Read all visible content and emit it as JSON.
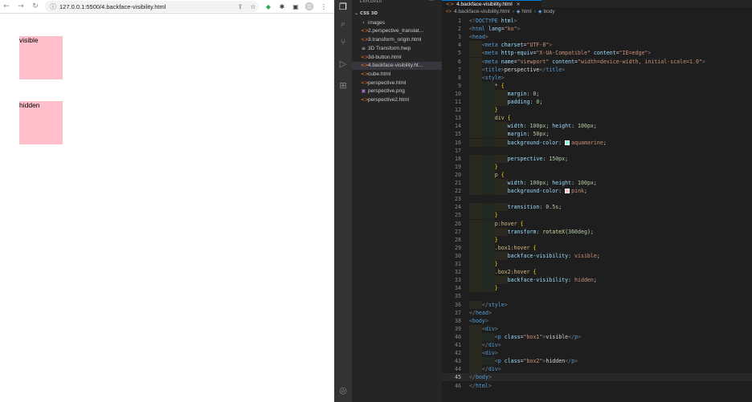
{
  "browser": {
    "url": "127.0.0.1:5500/4.backface-visibility.html",
    "boxes": [
      {
        "label": "visible"
      },
      {
        "label": "hidden"
      }
    ]
  },
  "vscode": {
    "explorer_title": "EXPLORER",
    "explorer_more": "···",
    "folder": "CSS 3D",
    "files": [
      {
        "name": "images",
        "icon": "folder-chevron-icon",
        "icon_color": "#cccccc"
      },
      {
        "name": "2.perspective_translat...",
        "icon": "html-file-icon",
        "icon_color": "#e37933"
      },
      {
        "name": "3.transform_origin.html",
        "icon": "html-file-icon",
        "icon_color": "#e37933"
      },
      {
        "name": "3D Transform.hwp",
        "icon": "lines-file-icon",
        "icon_color": "#cccccc"
      },
      {
        "name": "3d-button.html",
        "icon": "html-file-icon",
        "icon_color": "#e37933"
      },
      {
        "name": "4.backface-visibility.ht...",
        "icon": "html-file-icon",
        "icon_color": "#e37933"
      },
      {
        "name": "cube.html",
        "icon": "html-file-icon",
        "icon_color": "#e37933"
      },
      {
        "name": "perspective.html",
        "icon": "html-file-icon",
        "icon_color": "#e37933"
      },
      {
        "name": "perspective.png",
        "icon": "image-file-icon",
        "icon_color": "#a074c4"
      },
      {
        "name": "perspective2.html",
        "icon": "html-file-icon",
        "icon_color": "#e37933"
      }
    ],
    "tab": {
      "name": "4.backface-visibility.html",
      "close": "×"
    },
    "breadcrumb": [
      "4.backface-visibility.html",
      "html",
      "body"
    ],
    "current_line": 45,
    "code": [
      [
        [
          "c-punc",
          "<!"
        ],
        [
          "c-tag",
          "DOCTYPE"
        ],
        [
          "c-attr",
          " html"
        ],
        [
          "c-punc",
          ">"
        ]
      ],
      [
        [
          "c-punc",
          "<"
        ],
        [
          "c-tag",
          "html"
        ],
        [
          "c-attr",
          " lang"
        ],
        [
          "c-text",
          "="
        ],
        [
          "c-str",
          "\"ko\""
        ],
        [
          "c-punc",
          ">"
        ]
      ],
      [
        [
          "c-punc",
          "<"
        ],
        [
          "c-tag",
          "head"
        ],
        [
          "c-punc",
          ">"
        ]
      ],
      [
        [
          "c-text",
          "    "
        ],
        [
          "c-punc",
          "<"
        ],
        [
          "c-tag",
          "meta"
        ],
        [
          "c-attr",
          " charset"
        ],
        [
          "c-text",
          "="
        ],
        [
          "c-str",
          "\"UTF-8\""
        ],
        [
          "c-punc",
          ">"
        ]
      ],
      [
        [
          "c-text",
          "    "
        ],
        [
          "c-punc",
          "<"
        ],
        [
          "c-tag",
          "meta"
        ],
        [
          "c-attr",
          " http-equiv"
        ],
        [
          "c-text",
          "="
        ],
        [
          "c-str",
          "\"X-UA-Compatible\""
        ],
        [
          "c-attr",
          " content"
        ],
        [
          "c-text",
          "="
        ],
        [
          "c-str",
          "\"IE=edge\""
        ],
        [
          "c-punc",
          ">"
        ]
      ],
      [
        [
          "c-text",
          "    "
        ],
        [
          "c-punc",
          "<"
        ],
        [
          "c-tag",
          "meta"
        ],
        [
          "c-attr",
          " name"
        ],
        [
          "c-text",
          "="
        ],
        [
          "c-str",
          "\"viewport\""
        ],
        [
          "c-attr",
          " content"
        ],
        [
          "c-text",
          "="
        ],
        [
          "c-str",
          "\"width=device-width, initial-scale=1.0\""
        ],
        [
          "c-punc",
          ">"
        ]
      ],
      [
        [
          "c-text",
          "    "
        ],
        [
          "c-punc",
          "<"
        ],
        [
          "c-tag",
          "title"
        ],
        [
          "c-punc",
          ">"
        ],
        [
          "c-text",
          "perspective"
        ],
        [
          "c-punc",
          "</"
        ],
        [
          "c-tag",
          "title"
        ],
        [
          "c-punc",
          ">"
        ]
      ],
      [
        [
          "c-text",
          "    "
        ],
        [
          "c-punc",
          "<"
        ],
        [
          "c-tag",
          "style"
        ],
        [
          "c-punc",
          ">"
        ]
      ],
      [
        [
          "c-text",
          "        "
        ],
        [
          "c-sel",
          "*"
        ],
        [
          "c-text",
          " "
        ],
        [
          "c-brace",
          "{"
        ]
      ],
      [
        [
          "c-text",
          "            "
        ],
        [
          "c-prop",
          "margin"
        ],
        [
          "c-text",
          ": "
        ],
        [
          "c-num",
          "0"
        ],
        [
          "c-text",
          ";"
        ]
      ],
      [
        [
          "c-text",
          "            "
        ],
        [
          "c-prop",
          "padding"
        ],
        [
          "c-text",
          ": "
        ],
        [
          "c-num",
          "0"
        ],
        [
          "c-text",
          ";"
        ]
      ],
      [
        [
          "c-text",
          "        "
        ],
        [
          "c-brace",
          "}"
        ]
      ],
      [
        [
          "c-text",
          "        "
        ],
        [
          "c-sel",
          "div"
        ],
        [
          "c-text",
          " "
        ],
        [
          "c-brace",
          "{"
        ]
      ],
      [
        [
          "c-text",
          "            "
        ],
        [
          "c-prop",
          "width"
        ],
        [
          "c-text",
          ": "
        ],
        [
          "c-num",
          "100px"
        ],
        [
          "c-text",
          "; "
        ],
        [
          "c-prop",
          "height"
        ],
        [
          "c-text",
          ": "
        ],
        [
          "c-num",
          "100px"
        ],
        [
          "c-text",
          ";"
        ]
      ],
      [
        [
          "c-text",
          "            "
        ],
        [
          "c-prop",
          "margin"
        ],
        [
          "c-text",
          ": "
        ],
        [
          "c-num",
          "50px"
        ],
        [
          "c-text",
          ";"
        ]
      ],
      [
        [
          "c-text",
          "            "
        ],
        [
          "c-prop",
          "background-color"
        ],
        [
          "c-text",
          ": "
        ],
        [
          "swatch-aqua",
          ""
        ],
        [
          "c-val",
          "aquamarine"
        ],
        [
          "c-text",
          ";"
        ]
      ],
      [],
      [
        [
          "c-text",
          "            "
        ],
        [
          "c-prop",
          "perspective"
        ],
        [
          "c-text",
          ": "
        ],
        [
          "c-num",
          "150px"
        ],
        [
          "c-text",
          ";"
        ]
      ],
      [
        [
          "c-text",
          "        "
        ],
        [
          "c-brace",
          "}"
        ]
      ],
      [
        [
          "c-text",
          "        "
        ],
        [
          "c-sel",
          "p"
        ],
        [
          "c-text",
          " "
        ],
        [
          "c-brace",
          "{"
        ]
      ],
      [
        [
          "c-text",
          "            "
        ],
        [
          "c-prop",
          "width"
        ],
        [
          "c-text",
          ": "
        ],
        [
          "c-num",
          "100px"
        ],
        [
          "c-text",
          "; "
        ],
        [
          "c-prop",
          "height"
        ],
        [
          "c-text",
          ": "
        ],
        [
          "c-num",
          "100px"
        ],
        [
          "c-text",
          ";"
        ]
      ],
      [
        [
          "c-text",
          "            "
        ],
        [
          "c-prop",
          "background-color"
        ],
        [
          "c-text",
          ": "
        ],
        [
          "swatch-pink",
          ""
        ],
        [
          "c-val",
          "pink"
        ],
        [
          "c-text",
          ";"
        ]
      ],
      [],
      [
        [
          "c-text",
          "            "
        ],
        [
          "c-prop",
          "transition"
        ],
        [
          "c-text",
          ": "
        ],
        [
          "c-num",
          "0.5s"
        ],
        [
          "c-text",
          ";"
        ]
      ],
      [
        [
          "c-text",
          "        "
        ],
        [
          "c-brace",
          "}"
        ]
      ],
      [
        [
          "c-text",
          "        "
        ],
        [
          "c-sel",
          "p:hover"
        ],
        [
          "c-text",
          " "
        ],
        [
          "c-brace",
          "{"
        ]
      ],
      [
        [
          "c-text",
          "            "
        ],
        [
          "c-prop",
          "transform"
        ],
        [
          "c-text",
          ": "
        ],
        [
          "c-fn",
          "rotateX"
        ],
        [
          "c-text",
          "("
        ],
        [
          "c-num",
          "360deg"
        ],
        [
          "c-text",
          ");"
        ]
      ],
      [
        [
          "c-text",
          "        "
        ],
        [
          "c-brace",
          "}"
        ]
      ],
      [
        [
          "c-text",
          "        "
        ],
        [
          "c-sel",
          ".box1:hover"
        ],
        [
          "c-text",
          " "
        ],
        [
          "c-brace",
          "{"
        ]
      ],
      [
        [
          "c-text",
          "            "
        ],
        [
          "c-prop",
          "backface-visibility"
        ],
        [
          "c-text",
          ": "
        ],
        [
          "c-val",
          "visible"
        ],
        [
          "c-text",
          ";"
        ]
      ],
      [
        [
          "c-text",
          "        "
        ],
        [
          "c-brace",
          "}"
        ]
      ],
      [
        [
          "c-text",
          "        "
        ],
        [
          "c-sel",
          ".box2:hover"
        ],
        [
          "c-text",
          " "
        ],
        [
          "c-brace",
          "{"
        ]
      ],
      [
        [
          "c-text",
          "            "
        ],
        [
          "c-prop",
          "backface-visibility"
        ],
        [
          "c-text",
          ": "
        ],
        [
          "c-val",
          "hidden"
        ],
        [
          "c-text",
          ";"
        ]
      ],
      [
        [
          "c-text",
          "        "
        ],
        [
          "c-brace",
          "}"
        ]
      ],
      [],
      [
        [
          "c-text",
          "    "
        ],
        [
          "c-punc",
          "</"
        ],
        [
          "c-tag",
          "style"
        ],
        [
          "c-punc",
          ">"
        ]
      ],
      [
        [
          "c-punc",
          "</"
        ],
        [
          "c-tag",
          "head"
        ],
        [
          "c-punc",
          ">"
        ]
      ],
      [
        [
          "c-punc",
          "<"
        ],
        [
          "c-tag",
          "body"
        ],
        [
          "c-punc",
          ">"
        ]
      ],
      [
        [
          "c-text",
          "    "
        ],
        [
          "c-punc",
          "<"
        ],
        [
          "c-tag",
          "div"
        ],
        [
          "c-punc",
          ">"
        ]
      ],
      [
        [
          "c-text",
          "        "
        ],
        [
          "c-punc",
          "<"
        ],
        [
          "c-tag",
          "p"
        ],
        [
          "c-attr",
          " class"
        ],
        [
          "c-text",
          "="
        ],
        [
          "c-str",
          "\"box1\""
        ],
        [
          "c-punc",
          ">"
        ],
        [
          "c-text",
          "visible"
        ],
        [
          "c-punc",
          "</"
        ],
        [
          "c-tag",
          "p"
        ],
        [
          "c-punc",
          ">"
        ]
      ],
      [
        [
          "c-text",
          "    "
        ],
        [
          "c-punc",
          "</"
        ],
        [
          "c-tag",
          "div"
        ],
        [
          "c-punc",
          ">"
        ]
      ],
      [
        [
          "c-text",
          "    "
        ],
        [
          "c-punc",
          "<"
        ],
        [
          "c-tag",
          "div"
        ],
        [
          "c-punc",
          ">"
        ]
      ],
      [
        [
          "c-text",
          "        "
        ],
        [
          "c-punc",
          "<"
        ],
        [
          "c-tag",
          "p"
        ],
        [
          "c-attr",
          " class"
        ],
        [
          "c-text",
          "="
        ],
        [
          "c-str",
          "\"box2\""
        ],
        [
          "c-punc",
          ">"
        ],
        [
          "c-text",
          "hidden"
        ],
        [
          "c-punc",
          "</"
        ],
        [
          "c-tag",
          "p"
        ],
        [
          "c-punc",
          ">"
        ]
      ],
      [
        [
          "c-text",
          "    "
        ],
        [
          "c-punc",
          "</"
        ],
        [
          "c-tag",
          "div"
        ],
        [
          "c-punc",
          ">"
        ]
      ],
      [
        [
          "c-punc",
          "</"
        ],
        [
          "c-tag",
          "body"
        ],
        [
          "c-punc",
          ">"
        ]
      ],
      [
        [
          "c-punc",
          "</"
        ],
        [
          "c-tag",
          "html"
        ],
        [
          "c-punc",
          ">"
        ]
      ]
    ],
    "colors": {
      "aquamarine": "#7fffd4",
      "pink": "#ffc0cb",
      "accent": "#007acc"
    }
  }
}
